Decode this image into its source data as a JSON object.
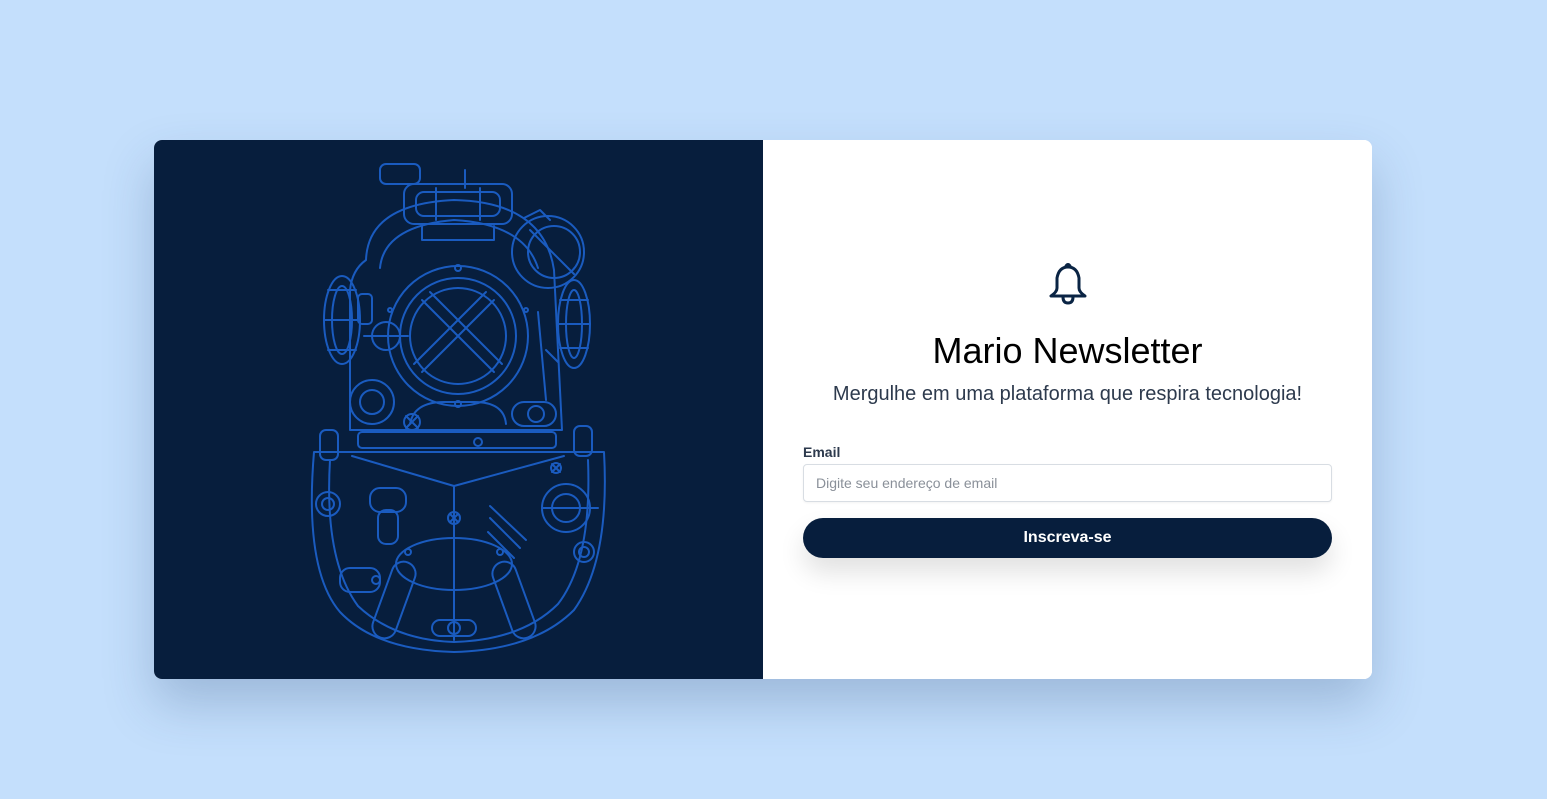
{
  "colors": {
    "background": "#c4dffc",
    "brand_dark": "#071e3d",
    "illustration_line": "#1c5fc7",
    "card": "#ffffff"
  },
  "illustration": {
    "icon": "diving-helmet-illustration"
  },
  "header": {
    "icon": "bell-icon",
    "title": "Mario Newsletter",
    "subtitle": "Mergulhe em uma plataforma que respira tecnologia!"
  },
  "form": {
    "email_label": "Email",
    "email_placeholder": "Digite seu endereço de email",
    "email_value": "",
    "submit_label": "Inscreva-se"
  }
}
